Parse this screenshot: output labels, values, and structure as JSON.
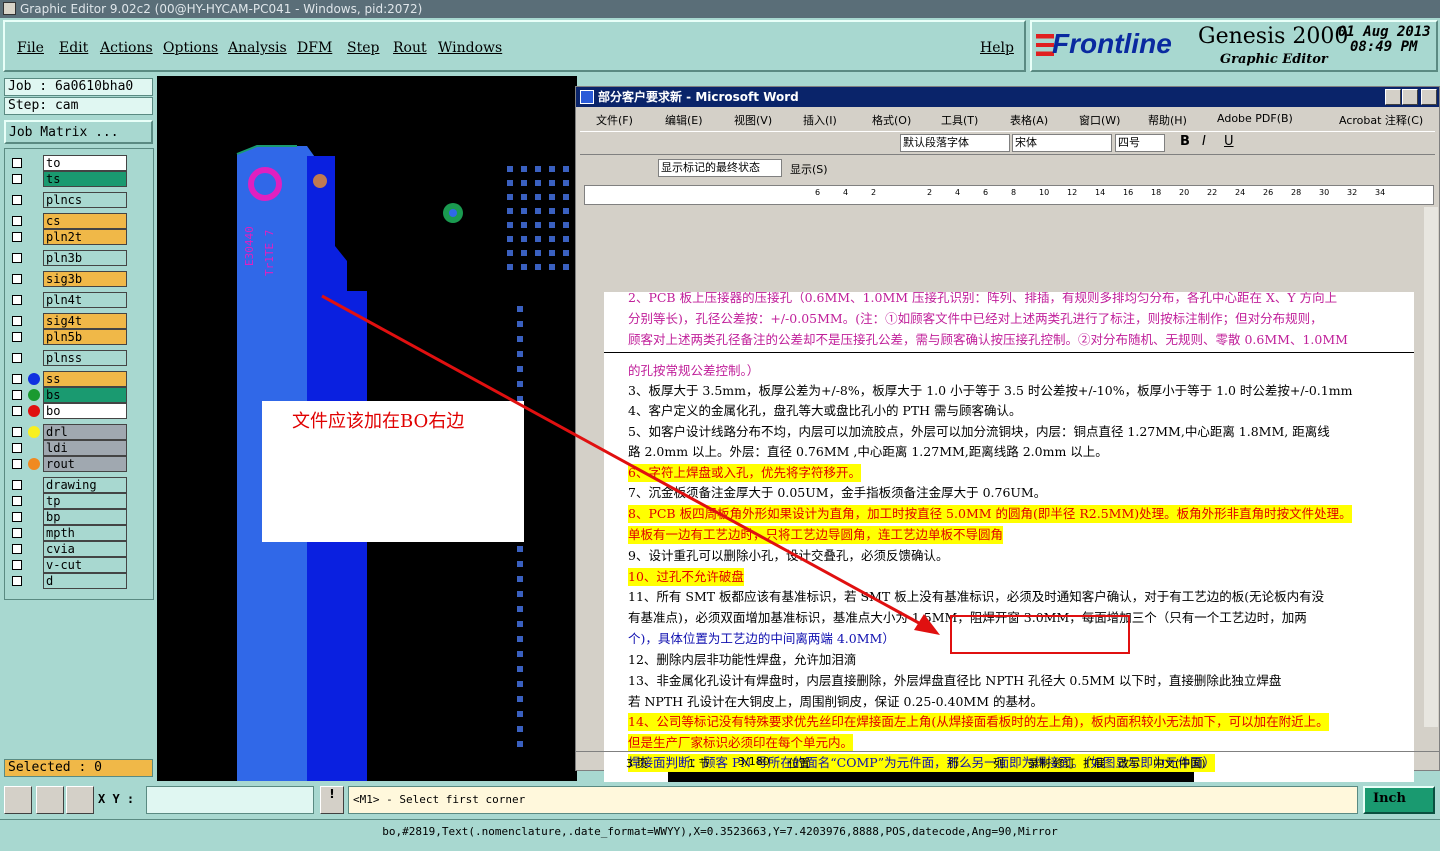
{
  "titlebar": {
    "text": "Graphic Editor 9.02c2 (00@HY-HYCAM-PC041 - Windows, pid:2072)"
  },
  "menu": [
    "File",
    "Edit",
    "Actions",
    "Options",
    "Analysis",
    "DFM",
    "Step",
    "Rout",
    "Windows"
  ],
  "help": "Help",
  "brand": {
    "logo": "Frontline",
    "product": "Genesis 2000",
    "subtitle": "Graphic Editor",
    "date": "01 Aug 2013",
    "time": "08:49 PM"
  },
  "job": "Job : 6a0610bha0",
  "step": "Step: cam",
  "job_matrix": "Job Matrix ...",
  "layers": [
    {
      "name": "to",
      "fill": "#ffffff",
      "dot": ""
    },
    {
      "name": "ts",
      "fill": "#1a9a70",
      "dot": ""
    },
    {
      "name": "plncs",
      "fill": "#a8d8d0",
      "dot": ""
    },
    {
      "name": "cs",
      "fill": "#f0b848",
      "dot": ""
    },
    {
      "name": "pln2t",
      "fill": "#f0b848",
      "dot": ""
    },
    {
      "name": "pln3b",
      "fill": "#a8d8d0",
      "dot": ""
    },
    {
      "name": "sig3b",
      "fill": "#f0b848",
      "dot": ""
    },
    {
      "name": "pln4t",
      "fill": "#a8d8d0",
      "dot": ""
    },
    {
      "name": "sig4t",
      "fill": "#f0b848",
      "dot": ""
    },
    {
      "name": "pln5b",
      "fill": "#f0b848",
      "dot": ""
    },
    {
      "name": "plnss",
      "fill": "#a8d8d0",
      "dot": ""
    },
    {
      "name": "ss",
      "fill": "#f0b848",
      "dot": "#1030e0"
    },
    {
      "name": "bs",
      "fill": "#1a9a70",
      "dot": "#1a9a30"
    },
    {
      "name": "bo",
      "fill": "#ffffff",
      "dot": "#e01010"
    },
    {
      "name": "drl",
      "fill": "#a0a8b0",
      "dot": "#f8f020"
    },
    {
      "name": "ldi",
      "fill": "#a0a8b0",
      "dot": ""
    },
    {
      "name": "rout",
      "fill": "#a0a8b0",
      "dot": "#f08a20"
    },
    {
      "name": "drawing",
      "fill": "#a8d8d0",
      "dot": ""
    },
    {
      "name": "tp",
      "fill": "#a8d8d0",
      "dot": ""
    },
    {
      "name": "bp",
      "fill": "#a8d8d0",
      "dot": ""
    },
    {
      "name": "mpth",
      "fill": "#a8d8d0",
      "dot": ""
    },
    {
      "name": "cvia",
      "fill": "#a8d8d0",
      "dot": ""
    },
    {
      "name": "v-cut",
      "fill": "#a8d8d0",
      "dot": ""
    },
    {
      "name": "d",
      "fill": "#a8d8d0",
      "dot": ""
    }
  ],
  "selected": "Selected : 0",
  "annotation_note": "文件应该加在BO右边",
  "xy_label": "X Y :",
  "prompt": "<M1> - Select first corner",
  "units": "Inch",
  "status_line": "bo,#2819,Text(.nomenclature,.date_format=WWYY),X=0.3523663,Y=7.4203976,8888,POS,datecode,Ang=90,Mirror",
  "word": {
    "title": "部分客户要求新 - Microsoft Word",
    "menus": [
      "文件(F)",
      "编辑(E)",
      "视图(V)",
      "插入(I)",
      "格式(O)",
      "工具(T)",
      "表格(A)",
      "窗口(W)",
      "帮助(H)",
      "Adobe PDF(B)",
      "Acrobat 注释(C)"
    ],
    "style": "默认段落字体",
    "font": "宋体",
    "size": "四号",
    "track": "显示标记的最终状态",
    "show": "显示(S)",
    "ruler": [
      "6",
      "4",
      "2",
      "",
      "2",
      "4",
      "6",
      "8",
      "10",
      "12",
      "14",
      "16",
      "18",
      "20",
      "22",
      "24",
      "26",
      "28",
      "30",
      "32",
      "34"
    ],
    "status": [
      "3 页",
      "1 节",
      "3/180",
      "位置",
      "行",
      "列",
      "录制",
      "修订",
      "扩展",
      "改写",
      "中文(中国)"
    ],
    "lines": [
      {
        "t": "2、PCB 板上压接器的压接孔（0.6MM、1.0MM 压接孔识别：阵列、排插，有规则多排均匀分布，各孔中心距在 X、Y 方向上",
        "c": "mag",
        "hl": false
      },
      {
        "t": "分别等长)，孔径公差按：+/-0.05MM。(注：①如顾客文件中已经对上述两类孔进行了标注，则按标注制作；但对分布规则，",
        "c": "mag",
        "hl": false
      },
      {
        "t": "顾客对上述两类孔径备注的公差却不是压接孔公差，需与顾客确认按压接孔控制。②对分布随机、无规则、零散 0.6MM、1.0MM",
        "c": "mag",
        "hl": false
      },
      {
        "t": "的孔按常规公差控制。）",
        "c": "mag",
        "hl": false
      },
      {
        "t": "3、板厚大于 3.5mm，板厚公差为+/-8%，板厚大于 1.0 小于等于 3.5 时公差按+/-10%，板厚小于等于 1.0 时公差按+/-0.1mm",
        "c": "",
        "hl": false
      },
      {
        "t": "4、客户定义的金属化孔，盘孔等大或盘比孔小的 PTH 需与顾客确认。",
        "c": "",
        "hl": false
      },
      {
        "t": "5、如客户设计线路分布不均，内层可以加流胶点，外层可以加分流铜块，内层：铜点直径 1.27MM,中心距离 1.8MM, 距离线",
        "c": "",
        "hl": false
      },
      {
        "t": "    路 2.0mm 以上。外层：直径 0.76MM ,中心距离 1.27MM,距离线路 2.0mm 以上。",
        "c": "",
        "hl": false
      },
      {
        "t": "6、字符上焊盘或入孔，优先将字符移开。",
        "c": "red",
        "hl": true
      },
      {
        "t": "7、沉金板须备注金厚大于 0.05UM，金手指板须备注金厚大于 0.76UM。",
        "c": "",
        "hl": false
      },
      {
        "t": "8、PCB 板四周板角外形如果设计为直角，加工时按直径 5.0MM 的圆角(即半径 R2.5MM)处理。板角外形非直角时按文件处理。",
        "c": "red",
        "hl": true
      },
      {
        "t": "单板有一边有工艺边时，只将工艺边导圆角，连工艺边单板不导圆角",
        "c": "red",
        "hl": true
      },
      {
        "t": "9、设计重孔可以删除小孔，设计交叠孔，必须反馈确认。",
        "c": "",
        "hl": false
      },
      {
        "t": "10、过孔不允许破盘",
        "c": "red",
        "hl": true
      },
      {
        "t": "11、所有 SMT 板都应该有基准标识，若 SMT 板上没有基准标识，必须及时通知客户确认，对于有工艺边的板(无论板内有没",
        "c": "",
        "hl": false
      },
      {
        "t": "     有基准点)，必须双面增加基准标识，基准点大小为 1.5MM，阻焊开窗 3.0MM，每面增加三个（只有一个工艺边时，加两",
        "c": "",
        "hl": false
      },
      {
        "t": "     个)，具体位置为工艺边的中间离两端 4.0MM）",
        "c": "blu",
        "hl": false
      },
      {
        "t": "12、删除内层非功能性焊盘，允许加泪滴",
        "c": "",
        "hl": false
      },
      {
        "t": "13、非金属化孔设计有焊盘时，内层直接删除，外层焊盘直径比 NPTH 孔径大 0.5MM 以下时，直接删除此独立焊盘",
        "c": "",
        "hl": false
      },
      {
        "t": "     若 NPTH 孔设计在大铜皮上，周围削铜皮，保证 0.25-0.40MM 的基材。",
        "c": "",
        "hl": false
      },
      {
        "t": "14、公司等标记没有特殊要求优先丝印在焊接面左上角(从焊接面看板时的左上角)，板内面积较小无法加下，可以加在附近上。",
        "c": "red",
        "hl": true
      },
      {
        "t": "     但是生产厂家标识必须印在每个单元内。",
        "c": "red",
        "hl": true
      },
      {
        "t": "        焊接面判断：顾客 PN 号所在的面名“COMP”为元件面，那么另一面即为焊接面。（如图显示即为元件面）",
        "c": "blu",
        "hl": true
      }
    ]
  },
  "colors": {
    "panel": "#a8d8d0",
    "word_title": "#0a246a",
    "arrow": "#e01010"
  }
}
